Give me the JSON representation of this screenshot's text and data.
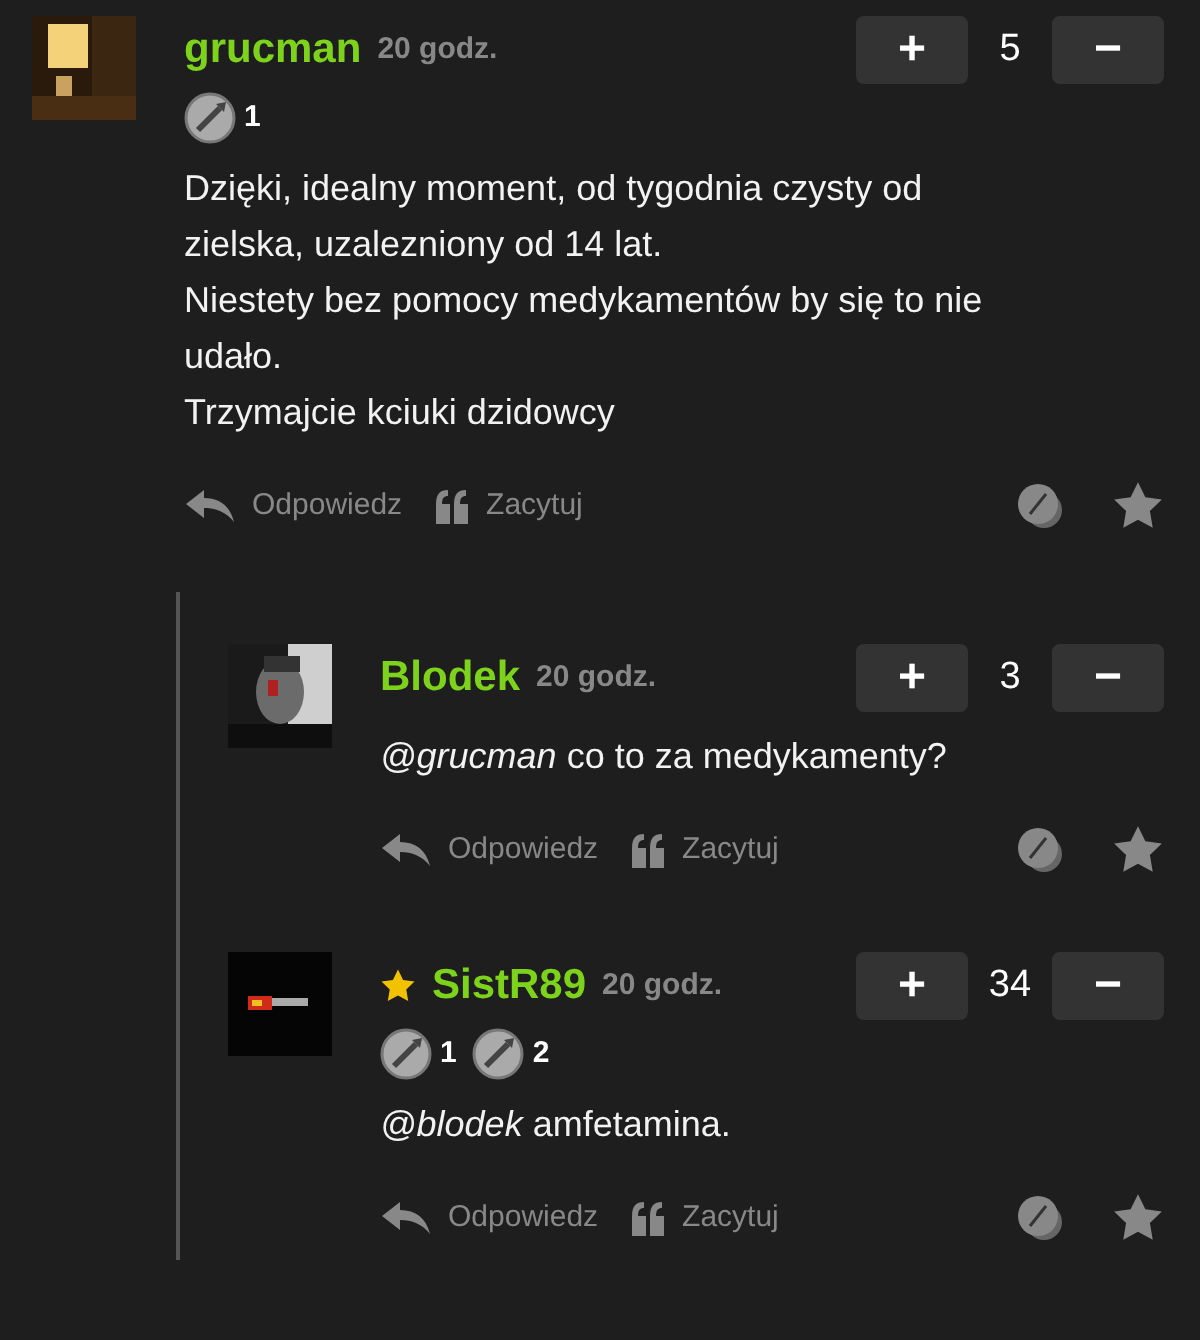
{
  "comments": [
    {
      "author": "grucman",
      "time": "20 godz.",
      "starred": false,
      "score": "5",
      "plus": "+",
      "minus": "−",
      "badges": [
        {
          "count": "1"
        }
      ],
      "paragraphs": [
        "Dzięki, idealny moment, od tygodnia czysty od zielska, uzalezniony od 14 lat.",
        "Niestety bez pomocy medykamentów by się to nie udało.",
        "Trzymajcie kciuki dzidowcy"
      ],
      "actions": [
        "Odpowiedz",
        "Zacytuj"
      ],
      "reply": false
    },
    {
      "author": "Blodek",
      "time": "20 godz.",
      "starred": false,
      "score": "3",
      "plus": "+",
      "minus": "−",
      "paragraphs": [
        "*@grucman* co to za medykamenty?"
      ],
      "actions": [
        "Odpowiedz",
        "Zacytuj"
      ],
      "reply": true
    },
    {
      "author": "SistR89",
      "time": "20 godz.",
      "starred": true,
      "score": "34",
      "plus": "+",
      "minus": "−",
      "badges": [
        {
          "count": "1"
        },
        {
          "count": "2"
        }
      ],
      "paragraphs": [
        "*@blodek* amfetamina."
      ],
      "actions": [
        "Odpowiedz",
        "Zacytuj"
      ],
      "reply": true
    }
  ]
}
